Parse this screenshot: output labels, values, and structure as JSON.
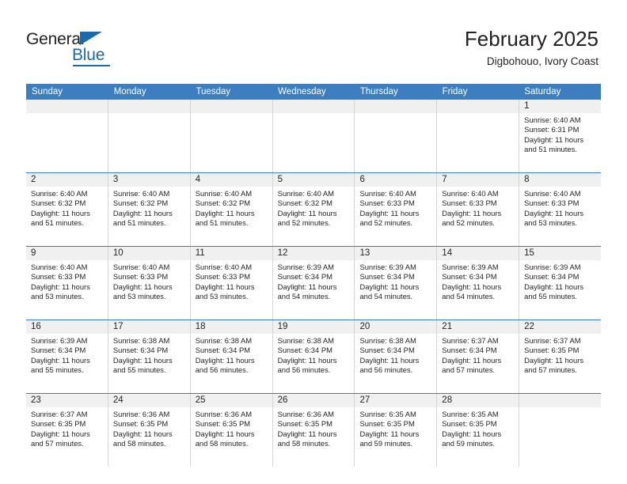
{
  "brand": {
    "name_part1": "General",
    "name_part2": "Blue",
    "accent_color": "#1b6aad"
  },
  "header": {
    "month_title": "February 2025",
    "location": "Digbohouo, Ivory Coast"
  },
  "calendar": {
    "header_color": "#3c7ebf",
    "weekdays": [
      "Sunday",
      "Monday",
      "Tuesday",
      "Wednesday",
      "Thursday",
      "Friday",
      "Saturday"
    ],
    "weeks": [
      [
        {
          "day": "",
          "sunrise": "",
          "sunset": "",
          "daylight": "",
          "empty": true
        },
        {
          "day": "",
          "sunrise": "",
          "sunset": "",
          "daylight": "",
          "empty": true
        },
        {
          "day": "",
          "sunrise": "",
          "sunset": "",
          "daylight": "",
          "empty": true
        },
        {
          "day": "",
          "sunrise": "",
          "sunset": "",
          "daylight": "",
          "empty": true
        },
        {
          "day": "",
          "sunrise": "",
          "sunset": "",
          "daylight": "",
          "empty": true
        },
        {
          "day": "",
          "sunrise": "",
          "sunset": "",
          "daylight": "",
          "empty": true
        },
        {
          "day": "1",
          "sunrise": "Sunrise: 6:40 AM",
          "sunset": "Sunset: 6:31 PM",
          "daylight": "Daylight: 11 hours and 51 minutes.",
          "empty": false
        }
      ],
      [
        {
          "day": "2",
          "sunrise": "Sunrise: 6:40 AM",
          "sunset": "Sunset: 6:32 PM",
          "daylight": "Daylight: 11 hours and 51 minutes.",
          "empty": false
        },
        {
          "day": "3",
          "sunrise": "Sunrise: 6:40 AM",
          "sunset": "Sunset: 6:32 PM",
          "daylight": "Daylight: 11 hours and 51 minutes.",
          "empty": false
        },
        {
          "day": "4",
          "sunrise": "Sunrise: 6:40 AM",
          "sunset": "Sunset: 6:32 PM",
          "daylight": "Daylight: 11 hours and 51 minutes.",
          "empty": false
        },
        {
          "day": "5",
          "sunrise": "Sunrise: 6:40 AM",
          "sunset": "Sunset: 6:32 PM",
          "daylight": "Daylight: 11 hours and 52 minutes.",
          "empty": false
        },
        {
          "day": "6",
          "sunrise": "Sunrise: 6:40 AM",
          "sunset": "Sunset: 6:33 PM",
          "daylight": "Daylight: 11 hours and 52 minutes.",
          "empty": false
        },
        {
          "day": "7",
          "sunrise": "Sunrise: 6:40 AM",
          "sunset": "Sunset: 6:33 PM",
          "daylight": "Daylight: 11 hours and 52 minutes.",
          "empty": false
        },
        {
          "day": "8",
          "sunrise": "Sunrise: 6:40 AM",
          "sunset": "Sunset: 6:33 PM",
          "daylight": "Daylight: 11 hours and 53 minutes.",
          "empty": false
        }
      ],
      [
        {
          "day": "9",
          "sunrise": "Sunrise: 6:40 AM",
          "sunset": "Sunset: 6:33 PM",
          "daylight": "Daylight: 11 hours and 53 minutes.",
          "empty": false
        },
        {
          "day": "10",
          "sunrise": "Sunrise: 6:40 AM",
          "sunset": "Sunset: 6:33 PM",
          "daylight": "Daylight: 11 hours and 53 minutes.",
          "empty": false
        },
        {
          "day": "11",
          "sunrise": "Sunrise: 6:40 AM",
          "sunset": "Sunset: 6:33 PM",
          "daylight": "Daylight: 11 hours and 53 minutes.",
          "empty": false
        },
        {
          "day": "12",
          "sunrise": "Sunrise: 6:39 AM",
          "sunset": "Sunset: 6:34 PM",
          "daylight": "Daylight: 11 hours and 54 minutes.",
          "empty": false
        },
        {
          "day": "13",
          "sunrise": "Sunrise: 6:39 AM",
          "sunset": "Sunset: 6:34 PM",
          "daylight": "Daylight: 11 hours and 54 minutes.",
          "empty": false
        },
        {
          "day": "14",
          "sunrise": "Sunrise: 6:39 AM",
          "sunset": "Sunset: 6:34 PM",
          "daylight": "Daylight: 11 hours and 54 minutes.",
          "empty": false
        },
        {
          "day": "15",
          "sunrise": "Sunrise: 6:39 AM",
          "sunset": "Sunset: 6:34 PM",
          "daylight": "Daylight: 11 hours and 55 minutes.",
          "empty": false
        }
      ],
      [
        {
          "day": "16",
          "sunrise": "Sunrise: 6:39 AM",
          "sunset": "Sunset: 6:34 PM",
          "daylight": "Daylight: 11 hours and 55 minutes.",
          "empty": false
        },
        {
          "day": "17",
          "sunrise": "Sunrise: 6:38 AM",
          "sunset": "Sunset: 6:34 PM",
          "daylight": "Daylight: 11 hours and 55 minutes.",
          "empty": false
        },
        {
          "day": "18",
          "sunrise": "Sunrise: 6:38 AM",
          "sunset": "Sunset: 6:34 PM",
          "daylight": "Daylight: 11 hours and 56 minutes.",
          "empty": false
        },
        {
          "day": "19",
          "sunrise": "Sunrise: 6:38 AM",
          "sunset": "Sunset: 6:34 PM",
          "daylight": "Daylight: 11 hours and 56 minutes.",
          "empty": false
        },
        {
          "day": "20",
          "sunrise": "Sunrise: 6:38 AM",
          "sunset": "Sunset: 6:34 PM",
          "daylight": "Daylight: 11 hours and 56 minutes.",
          "empty": false
        },
        {
          "day": "21",
          "sunrise": "Sunrise: 6:37 AM",
          "sunset": "Sunset: 6:34 PM",
          "daylight": "Daylight: 11 hours and 57 minutes.",
          "empty": false
        },
        {
          "day": "22",
          "sunrise": "Sunrise: 6:37 AM",
          "sunset": "Sunset: 6:35 PM",
          "daylight": "Daylight: 11 hours and 57 minutes.",
          "empty": false
        }
      ],
      [
        {
          "day": "23",
          "sunrise": "Sunrise: 6:37 AM",
          "sunset": "Sunset: 6:35 PM",
          "daylight": "Daylight: 11 hours and 57 minutes.",
          "empty": false
        },
        {
          "day": "24",
          "sunrise": "Sunrise: 6:36 AM",
          "sunset": "Sunset: 6:35 PM",
          "daylight": "Daylight: 11 hours and 58 minutes.",
          "empty": false
        },
        {
          "day": "25",
          "sunrise": "Sunrise: 6:36 AM",
          "sunset": "Sunset: 6:35 PM",
          "daylight": "Daylight: 11 hours and 58 minutes.",
          "empty": false
        },
        {
          "day": "26",
          "sunrise": "Sunrise: 6:36 AM",
          "sunset": "Sunset: 6:35 PM",
          "daylight": "Daylight: 11 hours and 58 minutes.",
          "empty": false
        },
        {
          "day": "27",
          "sunrise": "Sunrise: 6:35 AM",
          "sunset": "Sunset: 6:35 PM",
          "daylight": "Daylight: 11 hours and 59 minutes.",
          "empty": false
        },
        {
          "day": "28",
          "sunrise": "Sunrise: 6:35 AM",
          "sunset": "Sunset: 6:35 PM",
          "daylight": "Daylight: 11 hours and 59 minutes.",
          "empty": false
        },
        {
          "day": "",
          "sunrise": "",
          "sunset": "",
          "daylight": "",
          "empty": true
        }
      ]
    ]
  }
}
